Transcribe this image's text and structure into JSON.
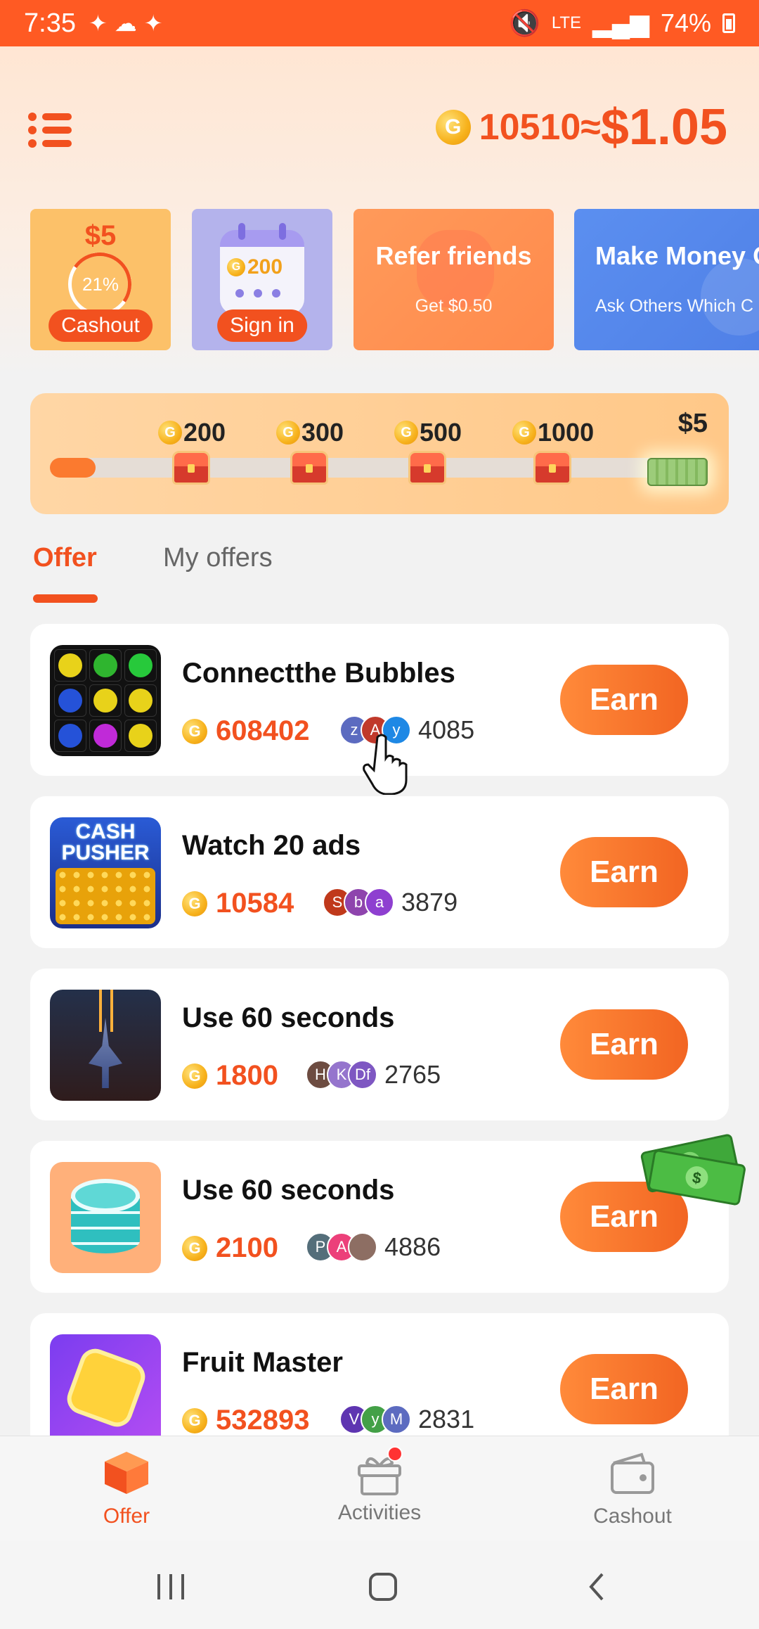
{
  "status_bar": {
    "time": "7:35",
    "signal_text": "LTE",
    "battery": "74%"
  },
  "header": {
    "coins": "10510",
    "approx": "≈",
    "usd": "$1.05",
    "coin_glyph": "G"
  },
  "feature_cards": {
    "cashout": {
      "amount": "$5",
      "percent": "21%",
      "button": "Cashout"
    },
    "signin": {
      "coins": "200",
      "button": "Sign in"
    },
    "refer": {
      "title": "Refer friends",
      "subtitle": "Get $0.50"
    },
    "money": {
      "title": "Make Money O",
      "subtitle": "Ask Others Which C"
    }
  },
  "progress": {
    "fraction": 0.07,
    "milestones": [
      "200",
      "300",
      "500",
      "1000"
    ],
    "final_reward": "$5"
  },
  "tabs": {
    "offer": "Offer",
    "my_offers": "My offers"
  },
  "offers": [
    {
      "name": "Connectthe Bubbles",
      "reward": "608402",
      "avatars": [
        "z",
        "A",
        "y"
      ],
      "avatar_colors": [
        "#5c6bc0",
        "#c0392b",
        "#1e88e5"
      ],
      "count": "4085",
      "button": "Earn"
    },
    {
      "name": "Watch 20 ads",
      "reward": "10584",
      "avatars": [
        "S",
        "b",
        "a"
      ],
      "avatar_colors": [
        "#c0391b",
        "#8e44ad",
        "#8e3fd0"
      ],
      "count": "3879",
      "button": "Earn"
    },
    {
      "name": "Use 60 seconds",
      "reward": "1800",
      "avatars": [
        "H",
        "K",
        "Df"
      ],
      "avatar_colors": [
        "#6d4c41",
        "#9575cd",
        "#7e57c2"
      ],
      "count": "2765",
      "button": "Earn"
    },
    {
      "name": "Use 60 seconds",
      "reward": "2100",
      "avatars": [
        "P",
        "A",
        ""
      ],
      "avatar_colors": [
        "#546e7a",
        "#ec407a",
        "#8d6e63"
      ],
      "count": "4886",
      "button": "Earn"
    },
    {
      "name": "Fruit Master",
      "reward": "532893",
      "avatars": [
        "V",
        "y",
        "M"
      ],
      "avatar_colors": [
        "#5e35b1",
        "#43a047",
        "#5c6bc0"
      ],
      "count": "2831",
      "button": "Earn"
    }
  ],
  "bottom_nav": {
    "offer": "Offer",
    "activities": "Activities",
    "cashout": "Cashout"
  },
  "icons": {
    "menu": "list-menu-icon",
    "coin": "gold-coin-icon",
    "offer": "cube-icon",
    "activities": "gift-icon",
    "cashout": "wallet-icon"
  },
  "colors": {
    "accent": "#f2511f",
    "status_bar": "#ff5a23"
  }
}
